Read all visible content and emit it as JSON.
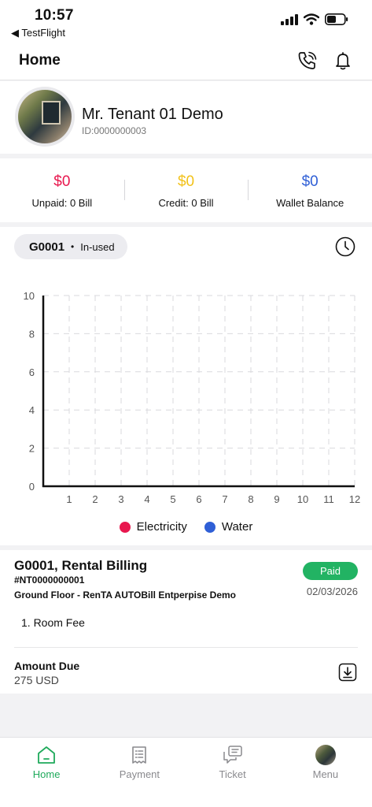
{
  "status_bar": {
    "time": "10:57",
    "back_app": "◀ TestFlight"
  },
  "header": {
    "title": "Home",
    "icons": [
      "phone-icon",
      "bell-icon"
    ]
  },
  "profile": {
    "name": "Mr. Tenant 01 Demo",
    "id": "ID:0000000003"
  },
  "balances": [
    {
      "amount": "$0",
      "label": "Unpaid: 0 Bill",
      "color": "#e8174e"
    },
    {
      "amount": "$0",
      "label": "Credit: 0 Bill",
      "color": "#f2c21a"
    },
    {
      "amount": "$0",
      "label": "Wallet Balance",
      "color": "#2f5fd6"
    }
  ],
  "meter": {
    "code": "G0001",
    "dot": "•",
    "status": "In-used"
  },
  "chart_data": {
    "type": "line",
    "x": [
      1,
      2,
      3,
      4,
      5,
      6,
      7,
      8,
      9,
      10,
      11,
      12
    ],
    "xlim": [
      0,
      12
    ],
    "ylim": [
      0,
      10
    ],
    "y_ticks": [
      0,
      2,
      4,
      6,
      8,
      10
    ],
    "x_tick_labels": [
      "1",
      "2",
      "3",
      "4",
      "5",
      "6",
      "7",
      "8",
      "9",
      "10",
      "11",
      "12"
    ],
    "grid": true,
    "series": [
      {
        "name": "Electricity",
        "color": "#e8174e",
        "values": []
      },
      {
        "name": "Water",
        "color": "#2f5fd6",
        "values": []
      }
    ],
    "legend_position": "bottom"
  },
  "bill": {
    "title": "G0001, Rental Billing",
    "number": "#NT0000000001",
    "location": "Ground Floor - RenTA AUTOBill Entperpise Demo",
    "status": "Paid",
    "status_color": "#22b363",
    "date": "02/03/2026",
    "items": [
      "1. Room Fee"
    ],
    "amount_due_label": "Amount Due",
    "amount_due_value": "275 USD"
  },
  "tabbar": {
    "tabs": [
      {
        "label": "Home",
        "icon": "home-icon",
        "active": true
      },
      {
        "label": "Payment",
        "icon": "receipt-icon",
        "active": false
      },
      {
        "label": "Ticket",
        "icon": "ticket-chat-icon",
        "active": false
      },
      {
        "label": "Menu",
        "icon": "avatar",
        "active": false
      }
    ],
    "active_color": "#1faa5b"
  }
}
